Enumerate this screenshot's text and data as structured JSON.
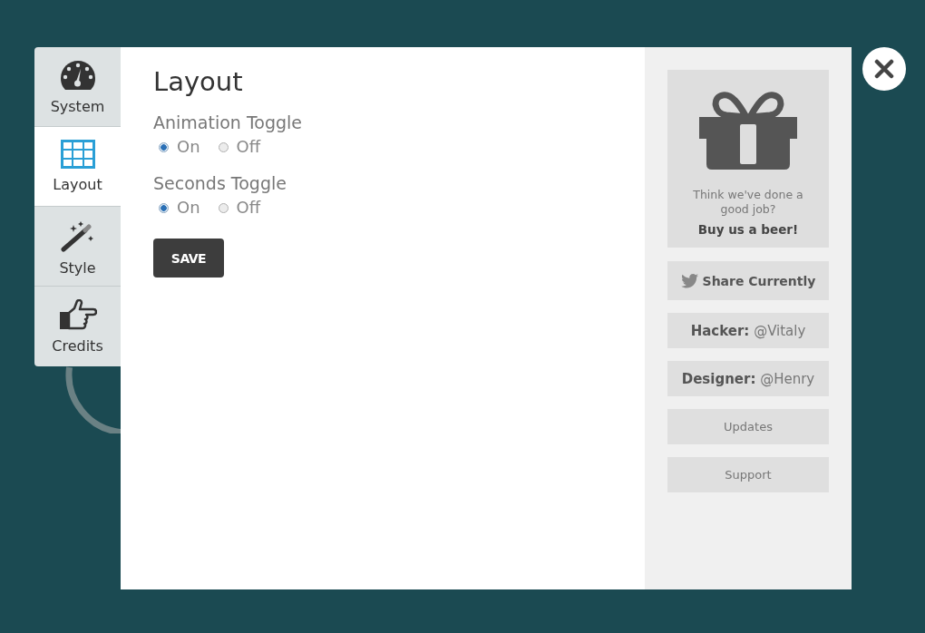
{
  "tabs": [
    {
      "label": "System",
      "selected": false
    },
    {
      "label": "Layout",
      "selected": true
    },
    {
      "label": "Style",
      "selected": false
    },
    {
      "label": "Credits",
      "selected": false
    }
  ],
  "main": {
    "title": "Layout",
    "settings": [
      {
        "label": "Animation Toggle",
        "options": [
          {
            "label": "On",
            "selected": true
          },
          {
            "label": "Off",
            "selected": false
          }
        ]
      },
      {
        "label": "Seconds Toggle",
        "options": [
          {
            "label": "On",
            "selected": true
          },
          {
            "label": "Off",
            "selected": false
          }
        ]
      }
    ],
    "save_button": "SAVE"
  },
  "sidebar": {
    "promo": {
      "text": "Think we've done a good job?",
      "link": "Buy us a beer!"
    },
    "buttons": [
      {
        "kind": "share",
        "label": "Share Currently"
      },
      {
        "kind": "credit",
        "label": "**Hacker:** @Vitaly"
      },
      {
        "kind": "credit",
        "label": "**Designer:** @Henry"
      },
      {
        "kind": "link",
        "label": "Updates"
      },
      {
        "kind": "link",
        "label": "Support"
      }
    ]
  }
}
